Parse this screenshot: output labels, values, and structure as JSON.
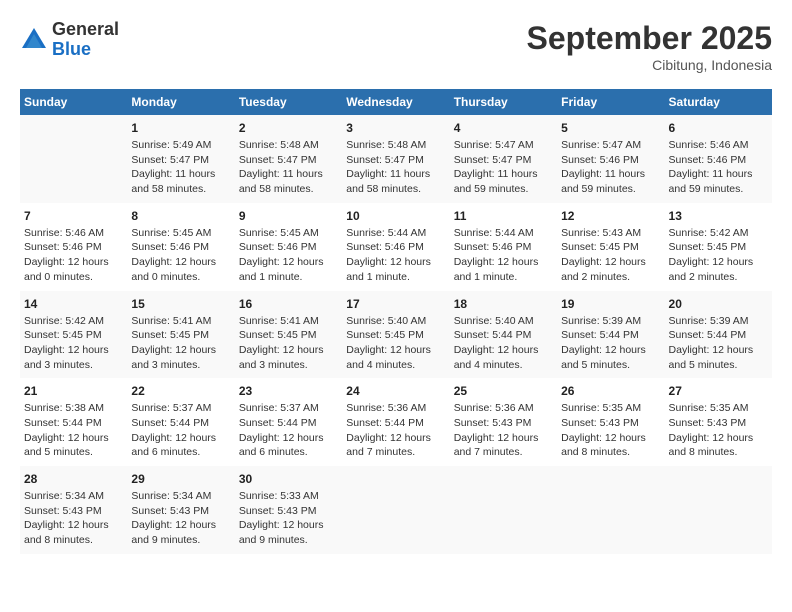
{
  "header": {
    "logo_general": "General",
    "logo_blue": "Blue",
    "month_title": "September 2025",
    "subtitle": "Cibitung, Indonesia"
  },
  "days_of_week": [
    "Sunday",
    "Monday",
    "Tuesday",
    "Wednesday",
    "Thursday",
    "Friday",
    "Saturday"
  ],
  "weeks": [
    [
      {
        "day": "",
        "info": ""
      },
      {
        "day": "1",
        "info": "Sunrise: 5:49 AM\nSunset: 5:47 PM\nDaylight: 11 hours\nand 58 minutes."
      },
      {
        "day": "2",
        "info": "Sunrise: 5:48 AM\nSunset: 5:47 PM\nDaylight: 11 hours\nand 58 minutes."
      },
      {
        "day": "3",
        "info": "Sunrise: 5:48 AM\nSunset: 5:47 PM\nDaylight: 11 hours\nand 58 minutes."
      },
      {
        "day": "4",
        "info": "Sunrise: 5:47 AM\nSunset: 5:47 PM\nDaylight: 11 hours\nand 59 minutes."
      },
      {
        "day": "5",
        "info": "Sunrise: 5:47 AM\nSunset: 5:46 PM\nDaylight: 11 hours\nand 59 minutes."
      },
      {
        "day": "6",
        "info": "Sunrise: 5:46 AM\nSunset: 5:46 PM\nDaylight: 11 hours\nand 59 minutes."
      }
    ],
    [
      {
        "day": "7",
        "info": "Sunrise: 5:46 AM\nSunset: 5:46 PM\nDaylight: 12 hours\nand 0 minutes."
      },
      {
        "day": "8",
        "info": "Sunrise: 5:45 AM\nSunset: 5:46 PM\nDaylight: 12 hours\nand 0 minutes."
      },
      {
        "day": "9",
        "info": "Sunrise: 5:45 AM\nSunset: 5:46 PM\nDaylight: 12 hours\nand 1 minute."
      },
      {
        "day": "10",
        "info": "Sunrise: 5:44 AM\nSunset: 5:46 PM\nDaylight: 12 hours\nand 1 minute."
      },
      {
        "day": "11",
        "info": "Sunrise: 5:44 AM\nSunset: 5:46 PM\nDaylight: 12 hours\nand 1 minute."
      },
      {
        "day": "12",
        "info": "Sunrise: 5:43 AM\nSunset: 5:45 PM\nDaylight: 12 hours\nand 2 minutes."
      },
      {
        "day": "13",
        "info": "Sunrise: 5:42 AM\nSunset: 5:45 PM\nDaylight: 12 hours\nand 2 minutes."
      }
    ],
    [
      {
        "day": "14",
        "info": "Sunrise: 5:42 AM\nSunset: 5:45 PM\nDaylight: 12 hours\nand 3 minutes."
      },
      {
        "day": "15",
        "info": "Sunrise: 5:41 AM\nSunset: 5:45 PM\nDaylight: 12 hours\nand 3 minutes."
      },
      {
        "day": "16",
        "info": "Sunrise: 5:41 AM\nSunset: 5:45 PM\nDaylight: 12 hours\nand 3 minutes."
      },
      {
        "day": "17",
        "info": "Sunrise: 5:40 AM\nSunset: 5:45 PM\nDaylight: 12 hours\nand 4 minutes."
      },
      {
        "day": "18",
        "info": "Sunrise: 5:40 AM\nSunset: 5:44 PM\nDaylight: 12 hours\nand 4 minutes."
      },
      {
        "day": "19",
        "info": "Sunrise: 5:39 AM\nSunset: 5:44 PM\nDaylight: 12 hours\nand 5 minutes."
      },
      {
        "day": "20",
        "info": "Sunrise: 5:39 AM\nSunset: 5:44 PM\nDaylight: 12 hours\nand 5 minutes."
      }
    ],
    [
      {
        "day": "21",
        "info": "Sunrise: 5:38 AM\nSunset: 5:44 PM\nDaylight: 12 hours\nand 5 minutes."
      },
      {
        "day": "22",
        "info": "Sunrise: 5:37 AM\nSunset: 5:44 PM\nDaylight: 12 hours\nand 6 minutes."
      },
      {
        "day": "23",
        "info": "Sunrise: 5:37 AM\nSunset: 5:44 PM\nDaylight: 12 hours\nand 6 minutes."
      },
      {
        "day": "24",
        "info": "Sunrise: 5:36 AM\nSunset: 5:44 PM\nDaylight: 12 hours\nand 7 minutes."
      },
      {
        "day": "25",
        "info": "Sunrise: 5:36 AM\nSunset: 5:43 PM\nDaylight: 12 hours\nand 7 minutes."
      },
      {
        "day": "26",
        "info": "Sunrise: 5:35 AM\nSunset: 5:43 PM\nDaylight: 12 hours\nand 8 minutes."
      },
      {
        "day": "27",
        "info": "Sunrise: 5:35 AM\nSunset: 5:43 PM\nDaylight: 12 hours\nand 8 minutes."
      }
    ],
    [
      {
        "day": "28",
        "info": "Sunrise: 5:34 AM\nSunset: 5:43 PM\nDaylight: 12 hours\nand 8 minutes."
      },
      {
        "day": "29",
        "info": "Sunrise: 5:34 AM\nSunset: 5:43 PM\nDaylight: 12 hours\nand 9 minutes."
      },
      {
        "day": "30",
        "info": "Sunrise: 5:33 AM\nSunset: 5:43 PM\nDaylight: 12 hours\nand 9 minutes."
      },
      {
        "day": "",
        "info": ""
      },
      {
        "day": "",
        "info": ""
      },
      {
        "day": "",
        "info": ""
      },
      {
        "day": "",
        "info": ""
      }
    ]
  ]
}
